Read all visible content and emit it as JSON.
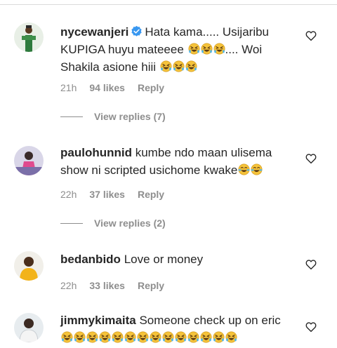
{
  "comments": [
    {
      "username": "nycewanjeri",
      "verified": true,
      "text_parts": [
        "Hata kama..... Usijaribu",
        "KUPIGA huyu mateeee",
        ".... Woi",
        "Shakila asione hiii"
      ],
      "time": "21h",
      "likes": "94 likes",
      "reply": "Reply",
      "view_replies": "View replies (7)"
    },
    {
      "username": "paulohunnid",
      "text_parts": [
        "kumbe ndo maan ulisema",
        "show ni scripted usichome kwake"
      ],
      "time": "22h",
      "likes": "37 likes",
      "reply": "Reply",
      "view_replies": "View replies (2)"
    },
    {
      "username": "bedanbido",
      "text": "Love or money",
      "time": "22h",
      "likes": "33 likes",
      "reply": "Reply"
    },
    {
      "username": "jimmykimaita",
      "text": "Someone check up on eric"
    }
  ],
  "icons": {
    "heart": "heart-outline-icon",
    "laugh_emoji": "rolling-on-floor-laughing",
    "tears_emoji": "face-with-tears-of-joy"
  },
  "colors": {
    "text": "#262626",
    "muted": "#8e8e8e",
    "verified": "#3897f0",
    "emoji": "#f5c33b"
  }
}
